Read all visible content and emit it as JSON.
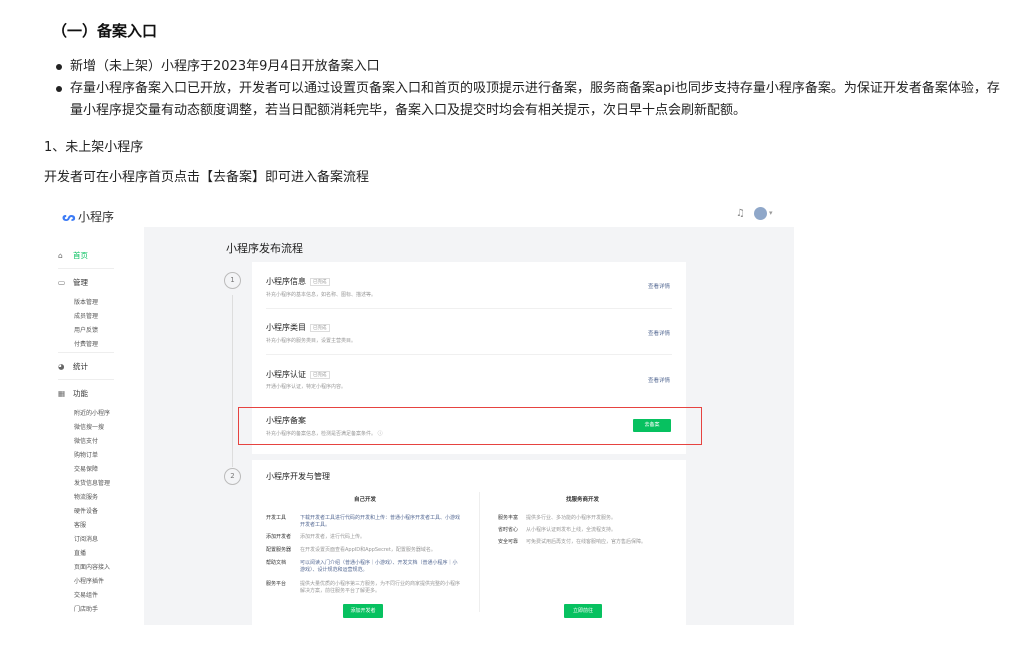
{
  "doc": {
    "heading": "（一）备案入口",
    "bullets": [
      "新增（未上架）小程序于2023年9月4日开放备案入口",
      "存量小程序备案入口已开放，开发者可以通过设置页备案入口和首页的吸顶提示进行备案，服务商备案api也同步支持存量小程序备案。为保证开发者备案体验，存量小程序提交量有动态额度调整，若当日配额消耗完毕，备案入口及提交时均会有相关提示，次日早十点会刷新配额。"
    ],
    "section": "1、未上架小程序",
    "paragraph": "开发者可在小程序首页点击【去备案】即可进入备案流程"
  },
  "screenshot": {
    "app_title": "小程序",
    "sidebar": {
      "home": "首页",
      "manage": "管理",
      "manage_items": [
        "版本管理",
        "成员管理",
        "用户反馈",
        "付费管理"
      ],
      "stats": "统计",
      "features": "功能",
      "feature_items": [
        "附近的小程序",
        "微信搜一搜",
        "微信支付",
        "购物订单",
        "交易保障",
        "发货信息管理",
        "物流服务",
        "硬件设备",
        "客服",
        "订阅消息",
        "直播",
        "页面内容接入",
        "小程序插件",
        "交易组件",
        "门店助手"
      ]
    },
    "main_title": "小程序发布流程",
    "step1": "1",
    "step2": "2",
    "rows": [
      {
        "title": "小程序信息",
        "tag": "已完成",
        "desc": "补充小程序的基本信息，如名称、图标、描述等。",
        "link": "查看详情"
      },
      {
        "title": "小程序类目",
        "tag": "已完成",
        "desc": "补充小程序的服务类目，设置主营类目。",
        "link": "查看详情"
      },
      {
        "title": "小程序认证",
        "tag": "已完成",
        "desc": "开通小程序认证，特定小程序内容。",
        "link": "查看详情"
      }
    ],
    "filing": {
      "title": "小程序备案",
      "desc": "补充小程序的备案信息，检测是否满足备案条件。 ⓘ",
      "button": "去备案"
    },
    "dev": {
      "title": "小程序开发与管理",
      "left_head": "自己开发",
      "right_head": "找服务商开发",
      "left_rows": [
        {
          "k": "开发工具",
          "v": "下载开发者工具进行代码的开发和上传：普通小程序开发者工具、小游戏开发者工具。"
        },
        {
          "k": "添加开发者",
          "v": "添加开发者，进行代码上传。"
        },
        {
          "k": "配置服务器",
          "v": "在开发设置页面查看AppID和AppSecret，配置服务器域名。"
        },
        {
          "k": "帮助文档",
          "v": "可以阅读入门介绍（普通小程序｜小游戏）、开发文档（普通小程序｜小游戏）、设计规范和运营规范。"
        },
        {
          "k": "服务平台",
          "v": "提供大量优质的小程序第三方服务，为不同行业的商家提供完整的小程序解决方案，前往服务平台了解更多。"
        }
      ],
      "right_rows": [
        {
          "k": "服务丰富",
          "v": "提供多行业、多功能的小程序开发服务。"
        },
        {
          "k": "省时省心",
          "v": "从小程序认证到发布上线，全流程支持。"
        },
        {
          "k": "安全可靠",
          "v": "可免费试用后再支付，在线客服响应，官方售后保障。"
        }
      ],
      "left_button": "添加开发者",
      "right_button": "立即前往"
    }
  }
}
